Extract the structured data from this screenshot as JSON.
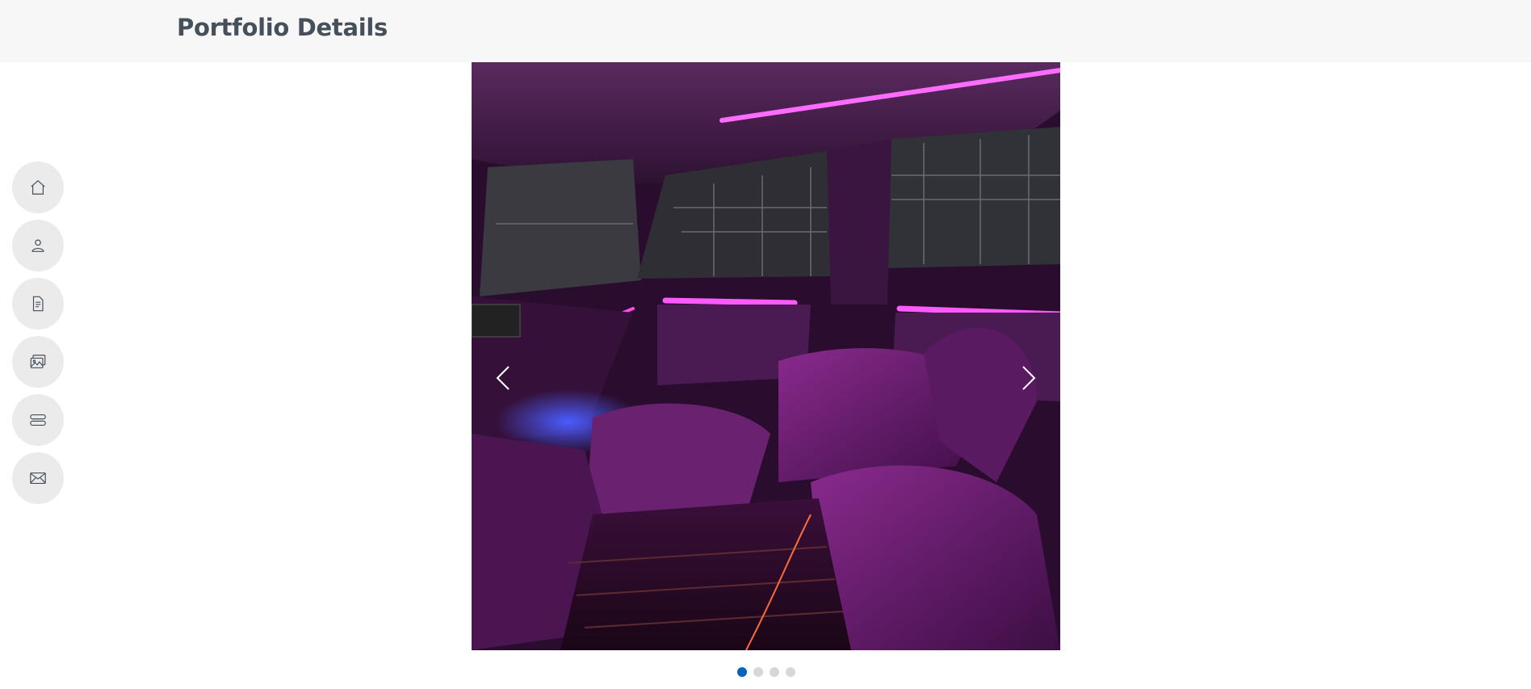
{
  "header": {
    "title": "Portfolio Details"
  },
  "nav": {
    "items": [
      {
        "name": "home",
        "icon": "home-icon"
      },
      {
        "name": "about",
        "icon": "person-icon"
      },
      {
        "name": "resume",
        "icon": "file-text-icon"
      },
      {
        "name": "portfolio",
        "icon": "images-icon"
      },
      {
        "name": "services",
        "icon": "server-icon"
      },
      {
        "name": "contact",
        "icon": "envelope-icon"
      }
    ]
  },
  "slider": {
    "image": "car interior with purple ambient lighting",
    "prev_icon": "chevron-left-icon",
    "next_icon": "chevron-right-icon",
    "slide_count": 4,
    "active_slide": 1
  },
  "colors": {
    "accent": "#0563bb",
    "header_bg": "#f7f7f7",
    "nav_bg": "#ebebeb",
    "title": "#45505b"
  }
}
